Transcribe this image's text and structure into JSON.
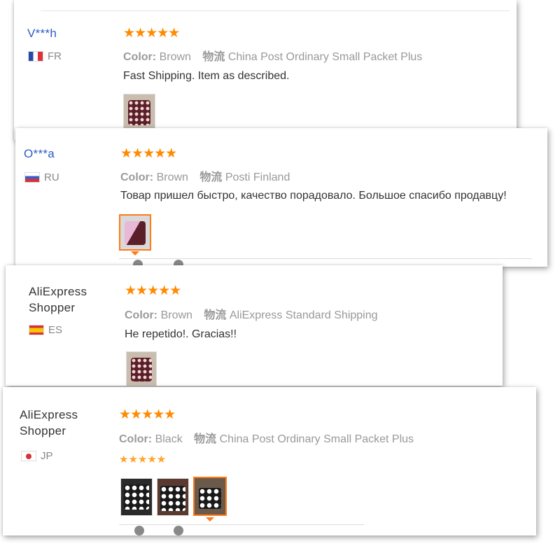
{
  "reviews": [
    {
      "user": "V***h",
      "country": "FR",
      "stars": "★★★★★",
      "color_label": "Color:",
      "color_value": "Brown",
      "logistics_label": "物流",
      "logistics_value": "China Post Ordinary Small Packet Plus",
      "text": "Fast Shipping. Item as described."
    },
    {
      "user": "O***a",
      "country": "RU",
      "stars": "★★★★★",
      "color_label": "Color:",
      "color_value": "Brown",
      "logistics_label": "物流",
      "logistics_value": "Posti Finland",
      "text": "Товар пришел быстро, качество порадовало. Большое спасибо продавцу!"
    },
    {
      "user": "AliExpress Shopper",
      "country": "ES",
      "stars": "★★★★★",
      "color_label": "Color:",
      "color_value": "Brown",
      "logistics_label": "物流",
      "logistics_value": "AliExpress Standard Shipping",
      "text": "He repetido!. Gracias!!"
    },
    {
      "user": "AliExpress Shopper",
      "country": "JP",
      "stars": "★★★★★",
      "color_label": "Color:",
      "color_value": "Black",
      "logistics_label": "物流",
      "logistics_value": "China Post Ordinary Small Packet Plus",
      "text": "★★★★★"
    }
  ],
  "colors": {
    "accent_star": "#ff8a00",
    "user_link": "#2c5cc5",
    "selected_border": "#ff7a1a"
  }
}
